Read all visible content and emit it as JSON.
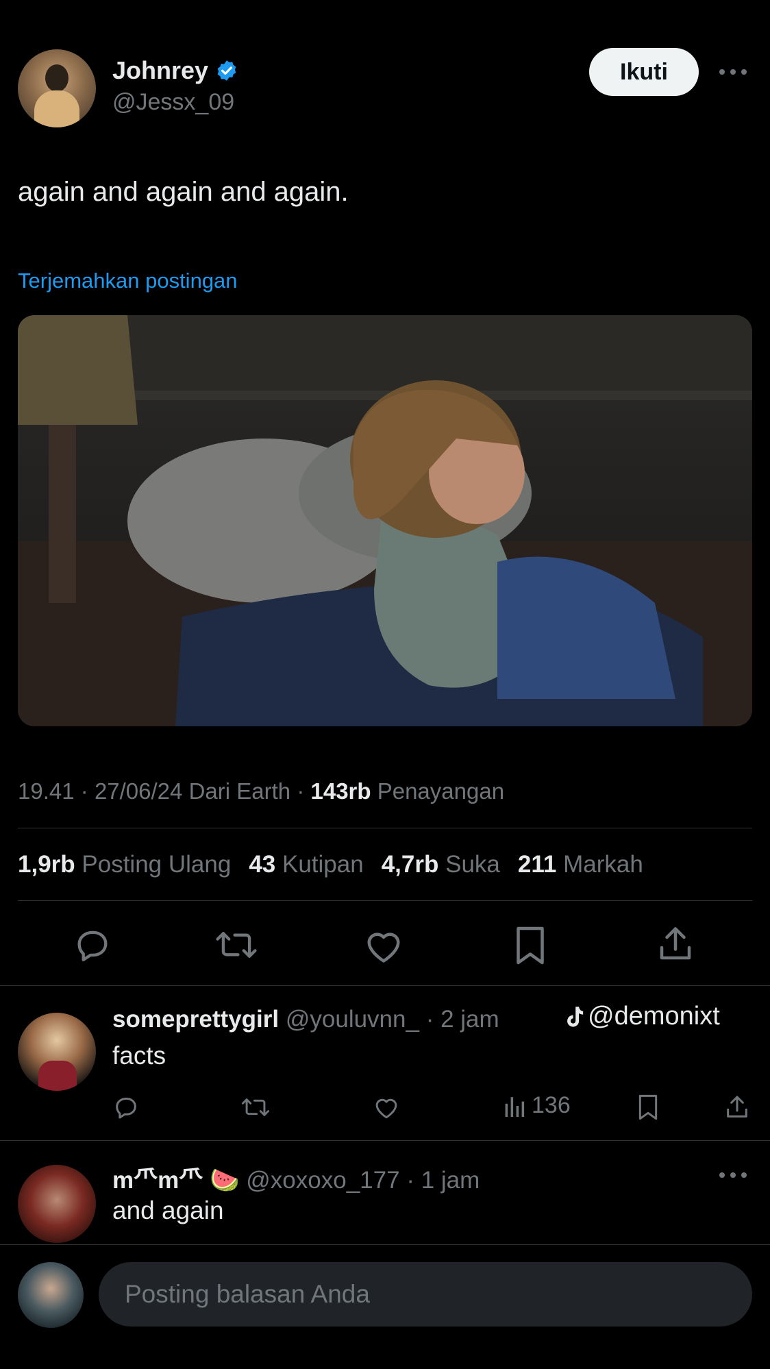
{
  "author": {
    "name": "Johnrey",
    "handle": "@Jessx_09",
    "follow_label": "Ikuti"
  },
  "tweet": {
    "text": "again and again and again.",
    "translate_label": "Terjemahkan postingan",
    "meta": {
      "time": "19.41",
      "date": "27/06/24",
      "source": "Dari Earth",
      "views_count": "143rb",
      "views_label": "Penayangan"
    },
    "stats": {
      "reposts_count": "1,9rb",
      "reposts_label": "Posting Ulang",
      "quotes_count": "43",
      "quotes_label": "Kutipan",
      "likes_count": "4,7rb",
      "likes_label": "Suka",
      "bookmarks_count": "211",
      "bookmarks_label": "Markah"
    }
  },
  "watermark": "@demonixt",
  "replies": [
    {
      "name": "someprettygirl",
      "handle": "@youluvnn_",
      "time": "· 2 jam",
      "text": "facts",
      "views": "136"
    },
    {
      "name": "m⺥m⺥ 🍉",
      "handle": "@xoxoxo_177",
      "time": "· 1 jam",
      "text": "and again"
    }
  ],
  "compose": {
    "placeholder": "Posting balasan Anda"
  },
  "colors": {
    "background": "#000000",
    "link": "#1d9bf0",
    "muted": "#71767b",
    "divider": "#2f3336",
    "verified": "#1d9bf0"
  },
  "icons": [
    "verified-badge-icon",
    "more-icon",
    "reply-icon",
    "repost-icon",
    "like-icon",
    "bookmark-icon",
    "share-icon",
    "views-icon",
    "tiktok-icon"
  ]
}
